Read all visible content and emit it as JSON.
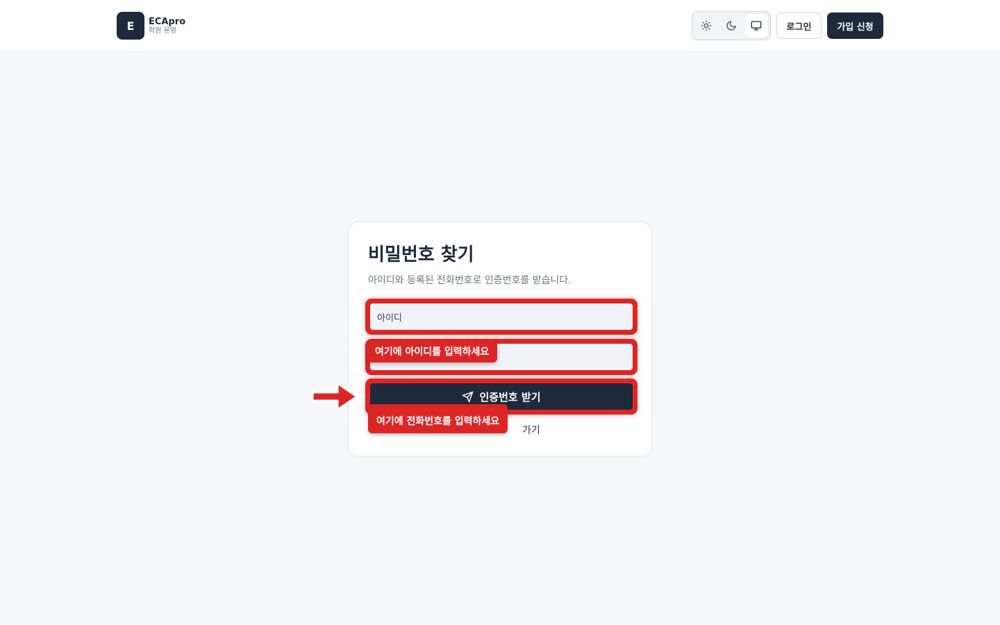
{
  "header": {
    "logo_letter": "E",
    "brand_name": "ECApro",
    "brand_sub": "학원 운영",
    "login_label": "로그인",
    "signup_label": "가입 신청",
    "theme_options": [
      "light",
      "dark",
      "system"
    ],
    "theme_selected": "system"
  },
  "card": {
    "title": "비밀번호 찾기",
    "description": "아이디와 등록된 전화번호로 인증번호를 받습니다.",
    "id_placeholder": "아이디",
    "submit_label": "인증번호 받기",
    "back_link_partial": "가기"
  },
  "annotations": {
    "id_tooltip": "여기에 아이디를 입력하세요",
    "phone_tooltip": "여기에 전화번호를 입력하세요",
    "highlight_color": "#dc2626"
  },
  "colors": {
    "primary": "#1e293b",
    "background": "#f5f7fb",
    "accent": "#dc2626"
  }
}
